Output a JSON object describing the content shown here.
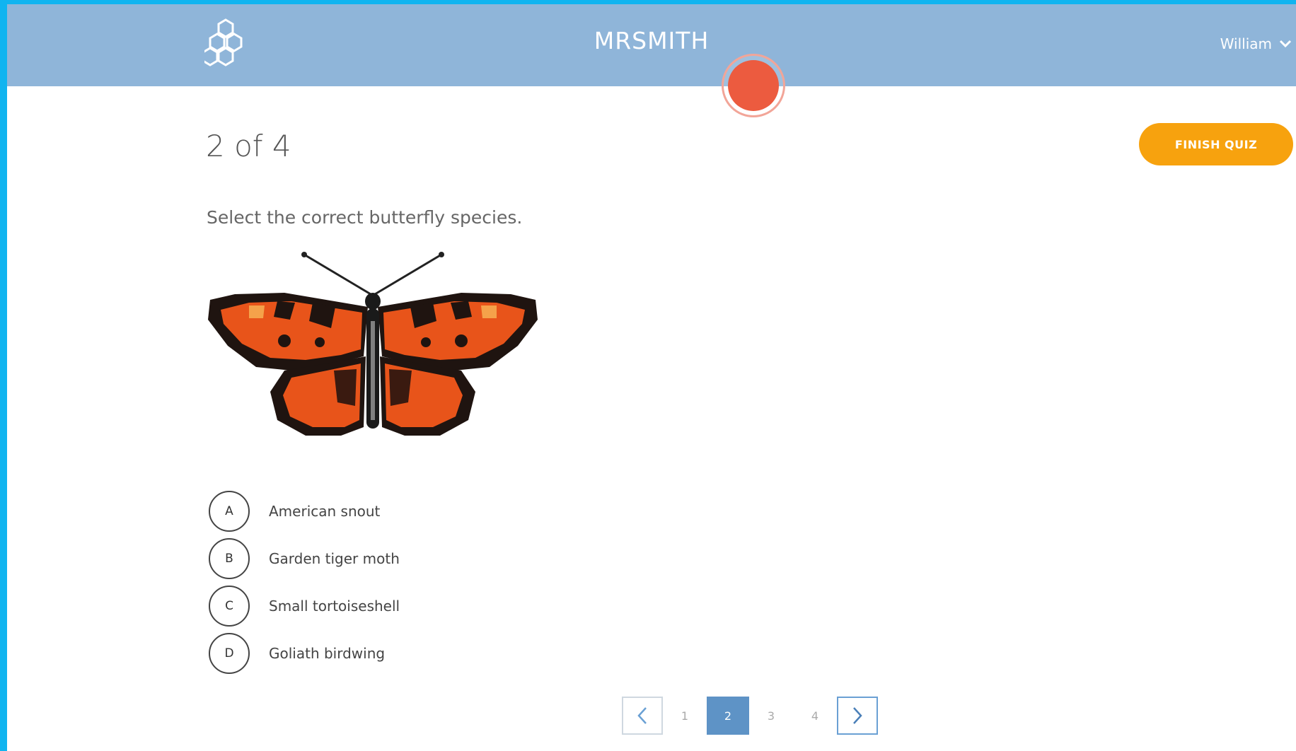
{
  "header": {
    "brand": "MRSMITH",
    "user_name": "William",
    "logo_icon": "hexagon-cluster-icon",
    "background_color": "#8fb5d9"
  },
  "quiz": {
    "progress": "2 of 4",
    "finish_label": "FINISH QUIZ",
    "finish_color": "#f7a20e",
    "question": "Select the correct butterfly species.",
    "image_icon": "butterfly-illustration",
    "options": [
      {
        "letter": "A",
        "text": "American snout"
      },
      {
        "letter": "B",
        "text": "Garden tiger moth"
      },
      {
        "letter": "C",
        "text": "Small tortoiseshell"
      },
      {
        "letter": "D",
        "text": "Goliath birdwing"
      }
    ]
  },
  "pagination": {
    "pages": [
      "1",
      "2",
      "3",
      "4"
    ],
    "current": "2",
    "prev_icon": "chevron-left-icon",
    "next_icon": "chevron-right-icon",
    "active_color": "#5e93c6"
  },
  "recorder": {
    "indicator_icon": "record-dot-icon",
    "color": "#ec5b3f"
  }
}
